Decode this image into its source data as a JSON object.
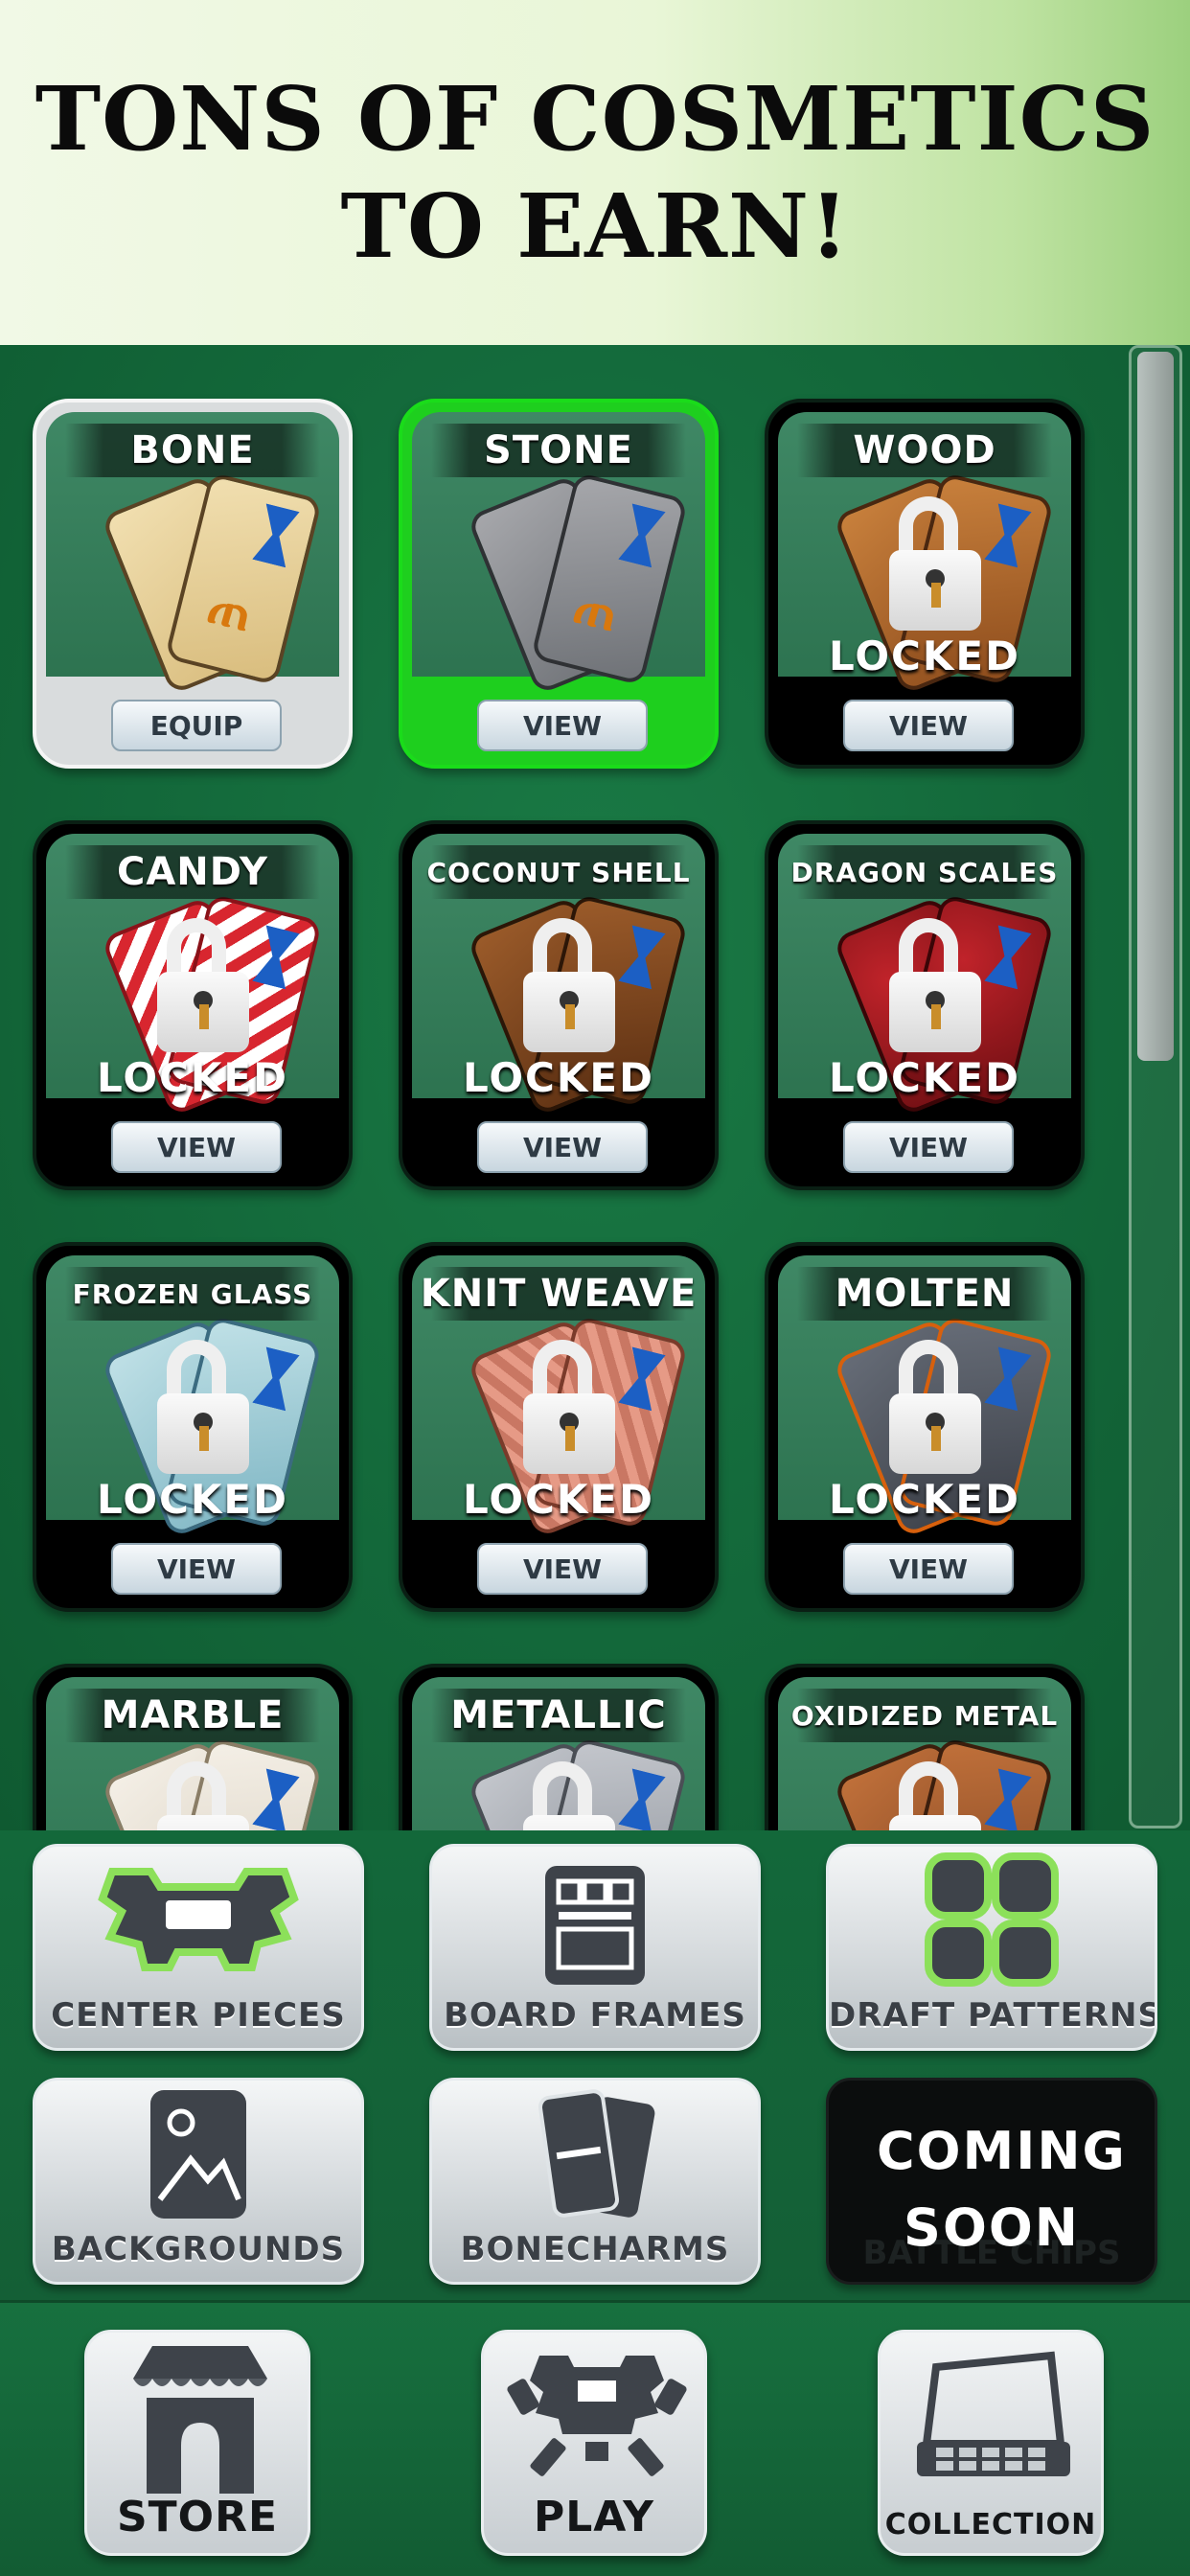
{
  "banner": {
    "line1": "TONS OF COSMETICS",
    "line2": "TO EARN!"
  },
  "cards": [
    {
      "name": "BONE",
      "status": "",
      "button": "EQUIP",
      "material": "bone",
      "style": "white"
    },
    {
      "name": "STONE",
      "status": "",
      "button": "VIEW",
      "material": "stone",
      "style": "green"
    },
    {
      "name": "WOOD",
      "status": "LOCKED",
      "button": "VIEW",
      "material": "wood",
      "style": "dark"
    },
    {
      "name": "CANDY",
      "status": "LOCKED",
      "button": "VIEW",
      "material": "candy",
      "style": "dark"
    },
    {
      "name": "COCONUT SHELL",
      "status": "LOCKED",
      "button": "VIEW",
      "material": "coco",
      "style": "dark"
    },
    {
      "name": "DRAGON SCALES",
      "status": "LOCKED",
      "button": "VIEW",
      "material": "dragon",
      "style": "dark"
    },
    {
      "name": "FROZEN GLASS",
      "status": "LOCKED",
      "button": "VIEW",
      "material": "frozen",
      "style": "dark"
    },
    {
      "name": "KNIT WEAVE",
      "status": "LOCKED",
      "button": "VIEW",
      "material": "knit",
      "style": "dark"
    },
    {
      "name": "MOLTEN",
      "status": "LOCKED",
      "button": "VIEW",
      "material": "molten",
      "style": "dark"
    },
    {
      "name": "MARBLE",
      "status": "",
      "button": "",
      "material": "marble",
      "style": "dark"
    },
    {
      "name": "METALLIC",
      "status": "",
      "button": "",
      "material": "metal",
      "style": "dark"
    },
    {
      "name": "OXIDIZED METAL",
      "status": "",
      "button": "",
      "material": "oxid",
      "style": "dark"
    }
  ],
  "categories": {
    "center_pieces": "CENTER PIECES",
    "board_frames": "BOARD FRAMES",
    "draft_patterns": "DRAFT PATTERNS",
    "backgrounds": "BACKGROUNDS",
    "bonecharms": "BONECHARMS",
    "coming_soon": "COMING SOON",
    "coming_soon_ghost": "BATTLE CHIPS"
  },
  "nav": {
    "store": "STORE",
    "play": "PLAY",
    "collection": "COLLECTION"
  },
  "colors": {
    "felt_green": "#13653a",
    "equipped_green": "#1ecf1e",
    "accent_blue": "#1c5fc4",
    "glyph_orange": "#d8780e"
  },
  "icons": [
    "lock-icon",
    "store-icon",
    "play-icon",
    "collection-icon",
    "center-pieces-icon",
    "board-frames-icon",
    "draft-patterns-icon",
    "backgrounds-icon",
    "bonecharms-icon"
  ]
}
